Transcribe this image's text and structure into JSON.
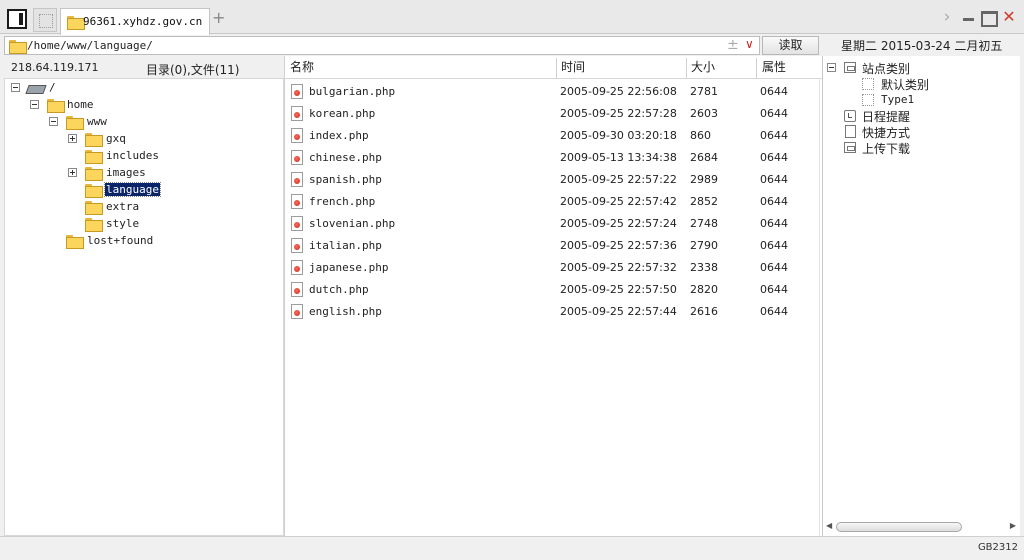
{
  "tab": {
    "title": "96361.xyhdz.gov.cn"
  },
  "address": {
    "path": "/home/www/language/",
    "read_button": "读取"
  },
  "date_line": "星期二 2015-03-24 二月初五",
  "info": {
    "ip": "218.64.119.171",
    "counts": "目录(0),文件(11)"
  },
  "tree": [
    {
      "label": "/"
    },
    {
      "label": "home"
    },
    {
      "label": "www"
    },
    {
      "label": "gxq"
    },
    {
      "label": "includes"
    },
    {
      "label": "images"
    },
    {
      "label": "language"
    },
    {
      "label": "extra"
    },
    {
      "label": "style"
    },
    {
      "label": "lost+found"
    }
  ],
  "columns": {
    "name": "名称",
    "time": "时间",
    "size": "大小",
    "attr": "属性"
  },
  "files": [
    {
      "name": "bulgarian.php",
      "time": "2005-09-25 22:56:08",
      "size": "2781",
      "attr": "0644"
    },
    {
      "name": "korean.php",
      "time": "2005-09-25 22:57:28",
      "size": "2603",
      "attr": "0644"
    },
    {
      "name": "index.php",
      "time": "2005-09-30 03:20:18",
      "size": "860",
      "attr": "0644"
    },
    {
      "name": "chinese.php",
      "time": "2009-05-13 13:34:38",
      "size": "2684",
      "attr": "0644"
    },
    {
      "name": "spanish.php",
      "time": "2005-09-25 22:57:22",
      "size": "2989",
      "attr": "0644"
    },
    {
      "name": "french.php",
      "time": "2005-09-25 22:57:42",
      "size": "2852",
      "attr": "0644"
    },
    {
      "name": "slovenian.php",
      "time": "2005-09-25 22:57:24",
      "size": "2748",
      "attr": "0644"
    },
    {
      "name": "italian.php",
      "time": "2005-09-25 22:57:36",
      "size": "2790",
      "attr": "0644"
    },
    {
      "name": "japanese.php",
      "time": "2005-09-25 22:57:32",
      "size": "2338",
      "attr": "0644"
    },
    {
      "name": "dutch.php",
      "time": "2005-09-25 22:57:50",
      "size": "2820",
      "attr": "0644"
    },
    {
      "name": "english.php",
      "time": "2005-09-25 22:57:44",
      "size": "2616",
      "attr": "0644"
    }
  ],
  "side": {
    "category": "站点类别",
    "default_category": "默认类别",
    "type1": "Type1",
    "schedule": "日程提醒",
    "shortcuts": "快捷方式",
    "transfers": "上传下载"
  },
  "status": {
    "encoding": "GB2312"
  }
}
